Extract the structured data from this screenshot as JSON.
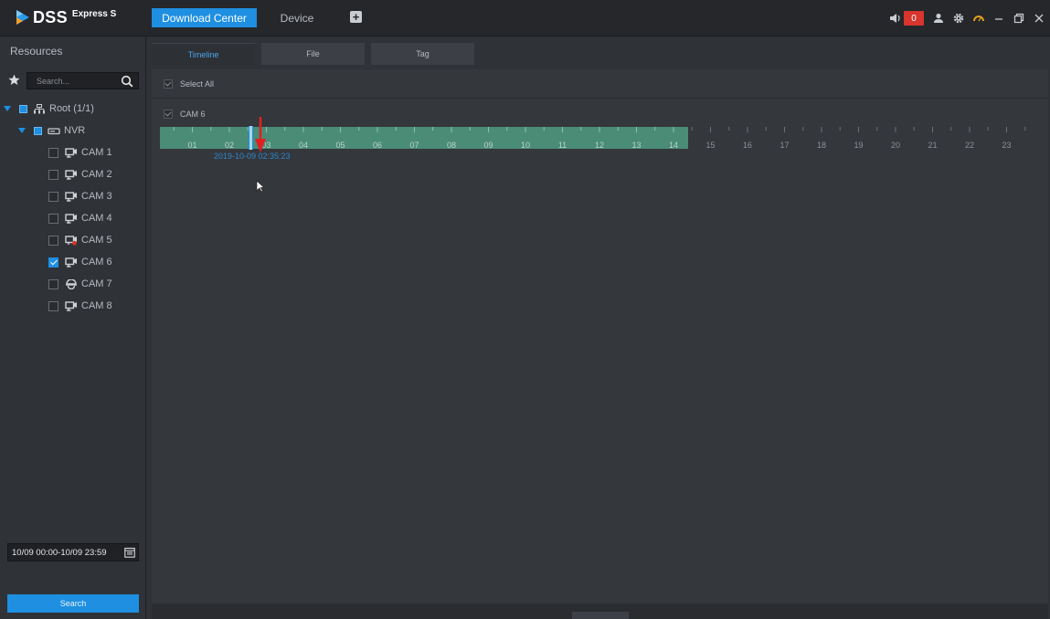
{
  "app": {
    "logo_text": "DSS",
    "logo_sub": "Express S",
    "nav": {
      "download_center": "Download Center",
      "device": "Device",
      "add_label": "+"
    },
    "alarm_count": "0",
    "accent_color": "#1e8fe1",
    "alarm_color": "#d7352d"
  },
  "sidebar": {
    "title": "Resources",
    "search_placeholder": "Search...",
    "root_label": "Root (1/1)",
    "nvr_label": "NVR",
    "cameras": [
      {
        "label": "CAM 1",
        "checked": false,
        "icon": "camera-icon"
      },
      {
        "label": "CAM 2",
        "checked": false,
        "icon": "camera-icon"
      },
      {
        "label": "CAM 3",
        "checked": false,
        "icon": "camera-icon"
      },
      {
        "label": "CAM 4",
        "checked": false,
        "icon": "camera-icon"
      },
      {
        "label": "CAM 5",
        "checked": false,
        "icon": "camera-offline-icon"
      },
      {
        "label": "CAM 6",
        "checked": true,
        "icon": "camera-icon"
      },
      {
        "label": "CAM 7",
        "checked": false,
        "icon": "dome-camera-icon"
      },
      {
        "label": "CAM 8",
        "checked": false,
        "icon": "camera-icon"
      }
    ],
    "date_range": "10/09 00:00-10/09 23:59",
    "search_button": "Search"
  },
  "main": {
    "tabs": [
      "Timeline",
      "File",
      "Tag"
    ],
    "active_tab": "Timeline",
    "select_all_label": "Select All",
    "channel_label": "CAM 6",
    "hour_labels": [
      "01",
      "02",
      "03",
      "04",
      "05",
      "06",
      "07",
      "08",
      "09",
      "10",
      "11",
      "12",
      "13",
      "14",
      "15",
      "16",
      "17",
      "18",
      "19",
      "20",
      "21",
      "22",
      "23"
    ],
    "recording_until_hour": 14.4,
    "cursor_time": "2019-10-09 02:35:23",
    "cursor_hour": 2.59
  }
}
